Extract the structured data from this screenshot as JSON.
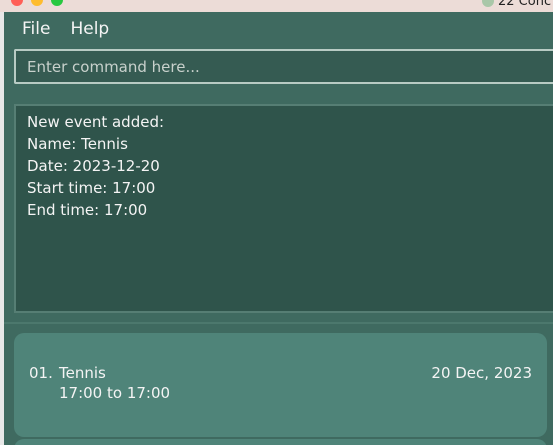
{
  "window": {
    "menu": {
      "file": "File",
      "help": "Help"
    },
    "command": {
      "placeholder": "Enter command here..."
    },
    "result": {
      "text": "New event added:\nName: Tennis\nDate: 2023-12-20\nStart time: 17:00\nEnd time: 17:00"
    },
    "events": [
      {
        "index": "01.",
        "name": "Tennis",
        "time_range": "17:00 to 17:00",
        "date": "20 Dec, 2023"
      }
    ]
  },
  "background": {
    "right_label": "22 Conc"
  },
  "colors": {
    "window_bg": "#3f6a60",
    "panel_bg": "#2f544b",
    "card_bg": "#4f8479",
    "text": "#f4f4f4"
  }
}
